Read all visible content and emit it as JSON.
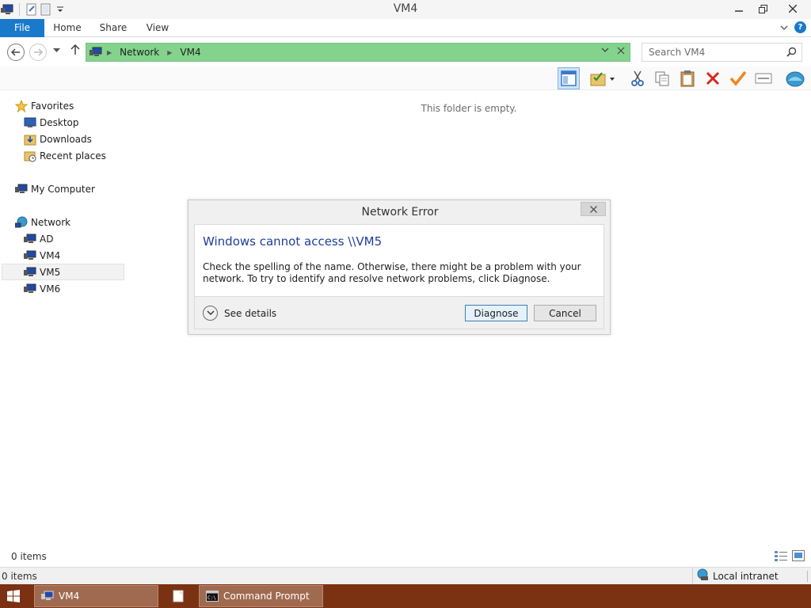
{
  "window": {
    "title": "VM4"
  },
  "ribbon": {
    "tabs": [
      "File",
      "Home",
      "Share",
      "View"
    ]
  },
  "address": {
    "crumbs": [
      "Network",
      "VM4"
    ],
    "color": "#83d38c"
  },
  "search": {
    "placeholder": "Search VM4"
  },
  "content": {
    "empty_message": "This folder is empty."
  },
  "nav_pane": {
    "favorites": {
      "label": "Favorites",
      "items": [
        "Desktop",
        "Downloads",
        "Recent places"
      ]
    },
    "my_computer": "My Computer",
    "network": {
      "label": "Network",
      "items": [
        "AD",
        "VM4",
        "VM5",
        "VM6"
      ],
      "selected": "VM5"
    }
  },
  "status": {
    "item_count": "0 items"
  },
  "ie_status": {
    "item_count": "0 items",
    "zone": "Local intranet"
  },
  "dialog": {
    "title": "Network Error",
    "heading": "Windows cannot access \\\\VM5",
    "message": "Check the spelling of the name. Otherwise, there might be a problem with your network. To try to identify and resolve network problems, click Diagnose.",
    "details_label": "See details",
    "diagnose_label": "Diagnose",
    "cancel_label": "Cancel"
  },
  "taskbar": {
    "items": [
      "VM4",
      "Command Prompt"
    ],
    "color": "#7a3212"
  }
}
